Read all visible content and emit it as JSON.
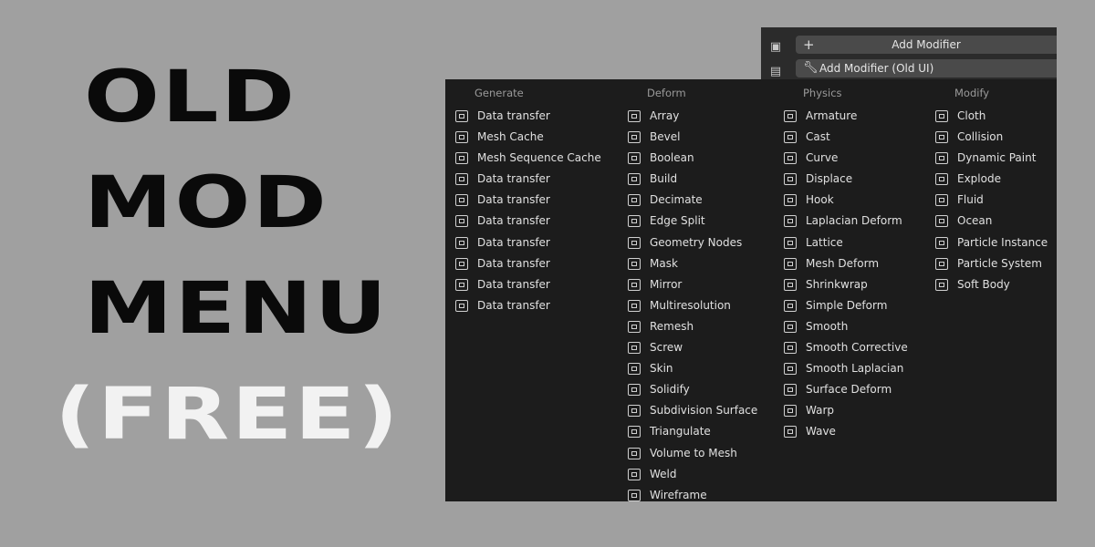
{
  "title": {
    "line1": "OLD",
    "line2": "MOD",
    "line3": "MENU",
    "line4": "(FREE)"
  },
  "properties_panel": {
    "add_modifier_label": "Add Modifier",
    "add_modifier_old_label": "Add Modifier (Old UI)"
  },
  "menu": {
    "columns": [
      {
        "key": "generate",
        "heading": "Generate",
        "items": [
          {
            "label": "Data transfer",
            "icon": "data-transfer-icon"
          },
          {
            "label": "Mesh Cache",
            "icon": "mesh-cache-icon"
          },
          {
            "label": "Mesh Sequence Cache",
            "icon": "mesh-sequence-cache-icon"
          },
          {
            "label": "Data transfer",
            "icon": "data-transfer-icon"
          },
          {
            "label": "Data transfer",
            "icon": "data-transfer-icon"
          },
          {
            "label": "Data transfer",
            "icon": "checker-icon"
          },
          {
            "label": "Data transfer",
            "icon": "checker-icon"
          },
          {
            "label": "Data transfer",
            "icon": "weight-icon"
          },
          {
            "label": "Data transfer",
            "icon": "weight-icon"
          },
          {
            "label": "Data transfer",
            "icon": "weight-icon"
          }
        ]
      },
      {
        "key": "deform",
        "heading": "Deform",
        "items": [
          {
            "label": "Array",
            "icon": "array-icon"
          },
          {
            "label": "Bevel",
            "icon": "bevel-icon"
          },
          {
            "label": "Boolean",
            "icon": "boolean-icon"
          },
          {
            "label": "Build",
            "icon": "build-icon"
          },
          {
            "label": "Decimate",
            "icon": "decimate-icon"
          },
          {
            "label": "Edge Split",
            "icon": "edge-split-icon"
          },
          {
            "label": "Geometry Nodes",
            "icon": "geometry-nodes-icon"
          },
          {
            "label": "Mask",
            "icon": "mask-icon"
          },
          {
            "label": "Mirror",
            "icon": "mirror-icon"
          },
          {
            "label": "Multiresolution",
            "icon": "multiresolution-icon"
          },
          {
            "label": "Remesh",
            "icon": "remesh-icon"
          },
          {
            "label": "Screw",
            "icon": "screw-icon"
          },
          {
            "label": "Skin",
            "icon": "skin-icon"
          },
          {
            "label": "Solidify",
            "icon": "solidify-icon"
          },
          {
            "label": "Subdivision Surface",
            "icon": "subdivision-surface-icon"
          },
          {
            "label": "Triangulate",
            "icon": "triangulate-icon"
          },
          {
            "label": "Volume to Mesh",
            "icon": "volume-to-mesh-icon"
          },
          {
            "label": "Weld",
            "icon": "weld-icon"
          },
          {
            "label": "Wireframe",
            "icon": "wireframe-icon"
          }
        ]
      },
      {
        "key": "physics",
        "heading": "Physics",
        "items": [
          {
            "label": "Armature",
            "icon": "armature-icon"
          },
          {
            "label": "Cast",
            "icon": "cast-icon"
          },
          {
            "label": "Curve",
            "icon": "curve-icon"
          },
          {
            "label": "Displace",
            "icon": "displace-icon"
          },
          {
            "label": "Hook",
            "icon": "hook-icon"
          },
          {
            "label": "Laplacian Deform",
            "icon": "laplacian-deform-icon"
          },
          {
            "label": "Lattice",
            "icon": "lattice-icon"
          },
          {
            "label": "Mesh Deform",
            "icon": "mesh-deform-icon"
          },
          {
            "label": "Shrinkwrap",
            "icon": "shrinkwrap-icon"
          },
          {
            "label": "Simple Deform",
            "icon": "simple-deform-icon"
          },
          {
            "label": "Smooth",
            "icon": "smooth-icon"
          },
          {
            "label": "Smooth Corrective",
            "icon": "smooth-corrective-icon"
          },
          {
            "label": "Smooth Laplacian",
            "icon": "smooth-laplacian-icon"
          },
          {
            "label": "Surface Deform",
            "icon": "surface-deform-icon"
          },
          {
            "label": "Warp",
            "icon": "warp-icon"
          },
          {
            "label": "Wave",
            "icon": "wave-icon"
          }
        ]
      },
      {
        "key": "modify",
        "heading": "Modify",
        "items": [
          {
            "label": "Cloth",
            "icon": "cloth-icon"
          },
          {
            "label": "Collision",
            "icon": "collision-icon"
          },
          {
            "label": "Dynamic Paint",
            "icon": "dynamic-paint-icon"
          },
          {
            "label": "Explode",
            "icon": "explode-icon"
          },
          {
            "label": "Fluid",
            "icon": "fluid-icon"
          },
          {
            "label": "Ocean",
            "icon": "ocean-icon"
          },
          {
            "label": "Particle Instance",
            "icon": "particle-instance-icon"
          },
          {
            "label": "Particle System",
            "icon": "particle-system-icon"
          },
          {
            "label": "Soft Body",
            "icon": "soft-body-icon"
          }
        ]
      }
    ]
  }
}
